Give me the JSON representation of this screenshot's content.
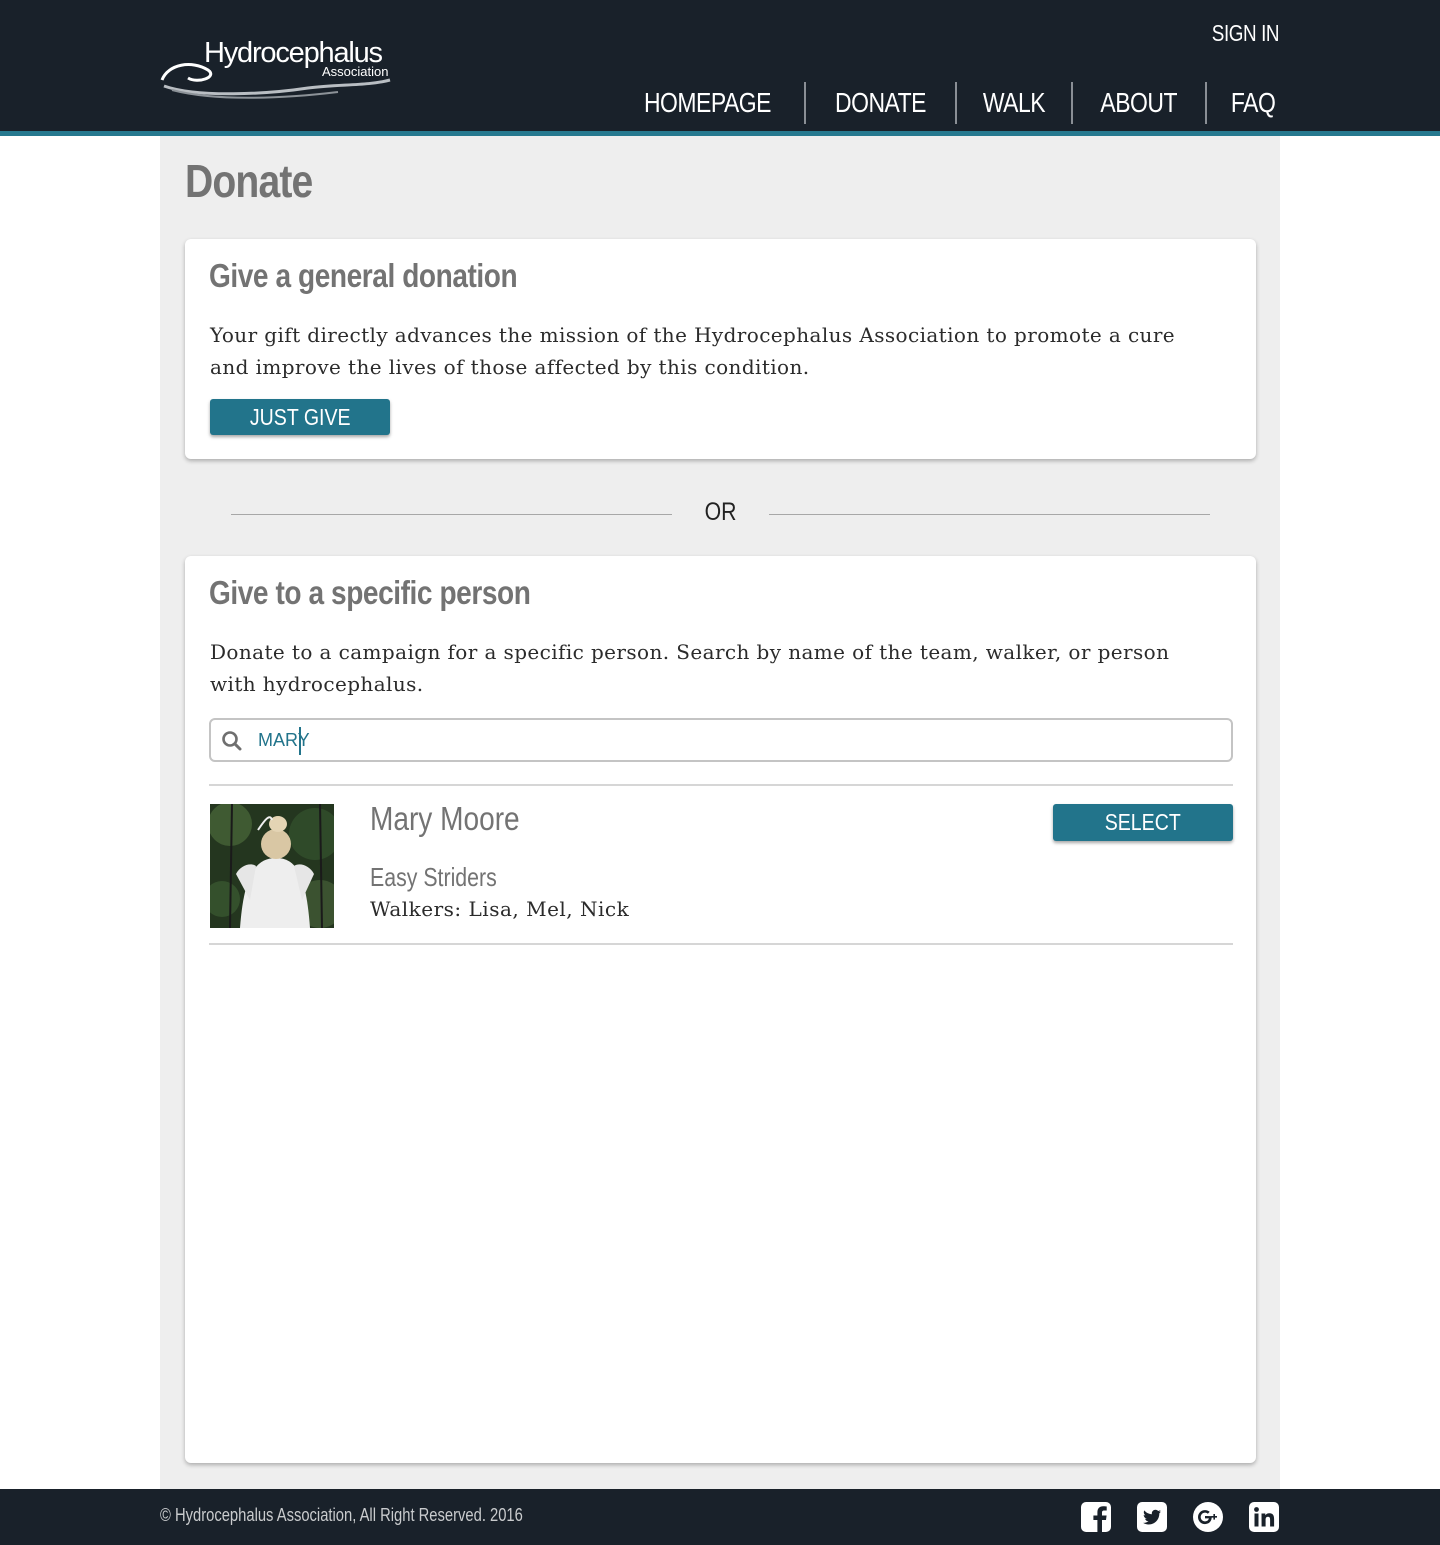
{
  "header": {
    "logo_text": "Hydrocephalus",
    "logo_subtext": "Association",
    "signin_label": "SIGN IN",
    "nav": [
      {
        "label": "HOMEPAGE"
      },
      {
        "label": "DONATE"
      },
      {
        "label": "WALK"
      },
      {
        "label": "ABOUT"
      },
      {
        "label": "FAQ"
      }
    ]
  },
  "page": {
    "title": "Donate"
  },
  "general": {
    "title": "Give a general donation",
    "text": "Your gift directly advances the mission of the Hydrocephalus Association to promote a cure and improve the lives of those affected by this condition.",
    "button_label": "JUST GIVE"
  },
  "separator": {
    "label": "OR"
  },
  "specific": {
    "title": "Give to a specific person",
    "text": "Donate to a campaign for a specific person. Search by name of the team, walker, or person with hydrocephalus.",
    "search_value": "MARY",
    "results": [
      {
        "name": "Mary Moore",
        "team": "Easy Striders",
        "walkers": "Walkers: Lisa, Mel, Nick",
        "button_label": "SELECT"
      }
    ]
  },
  "footer": {
    "copyright": "©  Hydrocephalus Association, All Right Reserved. 2016",
    "socials": [
      "facebook-icon",
      "twitter-icon",
      "google-plus-icon",
      "linkedin-icon"
    ]
  },
  "colors": {
    "header_bg": "#19212a",
    "accent": "#22748b",
    "panel_bg": "#eeeeee"
  }
}
